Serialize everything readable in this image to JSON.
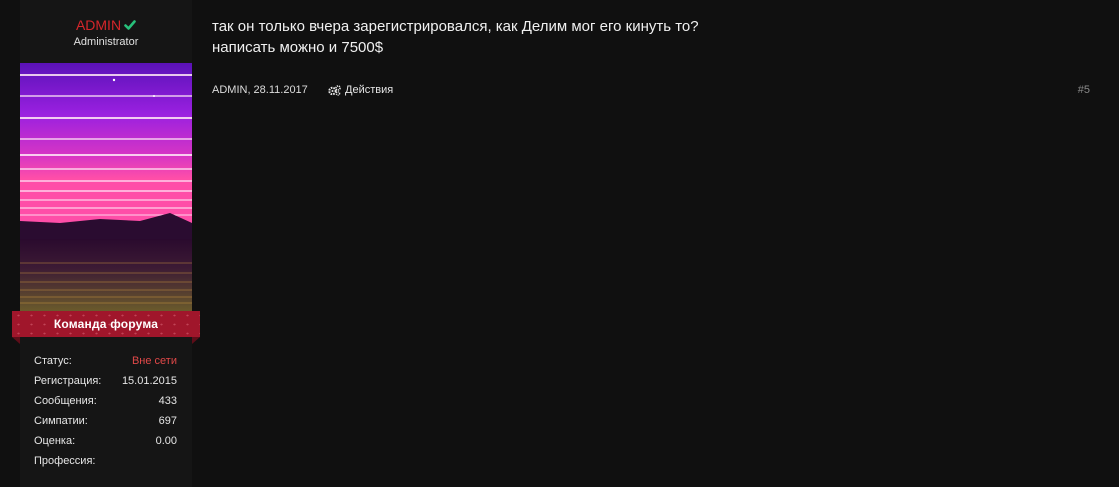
{
  "user": {
    "name": "ADMIN",
    "title": "Administrator",
    "banner": "Команда форума",
    "stats": [
      {
        "label": "Статус:",
        "value": "Вне сети"
      },
      {
        "label": "Регистрация:",
        "value": "15.01.2015"
      },
      {
        "label": "Сообщения:",
        "value": "433"
      },
      {
        "label": "Симпатии:",
        "value": "697"
      },
      {
        "label": "Оценка:",
        "value": "0.00"
      },
      {
        "label": "Профессия:",
        "value": ""
      }
    ]
  },
  "post": {
    "lines": [
      "так он только вчера зарегистрировался, как Делим мог его кинуть то?",
      "написать можно и 7500$"
    ],
    "author_date": "ADMIN, 28.11.2017",
    "actions_label": "Действия",
    "number": "#5"
  },
  "colors": {
    "background": "#101010",
    "sidebar": "#151515",
    "username": "#d6262b",
    "verified": "#27c07a",
    "banner": "#a0162b",
    "offline": "#e04848"
  },
  "icons": {
    "verified": "check-icon",
    "actions": "gears-icon"
  }
}
